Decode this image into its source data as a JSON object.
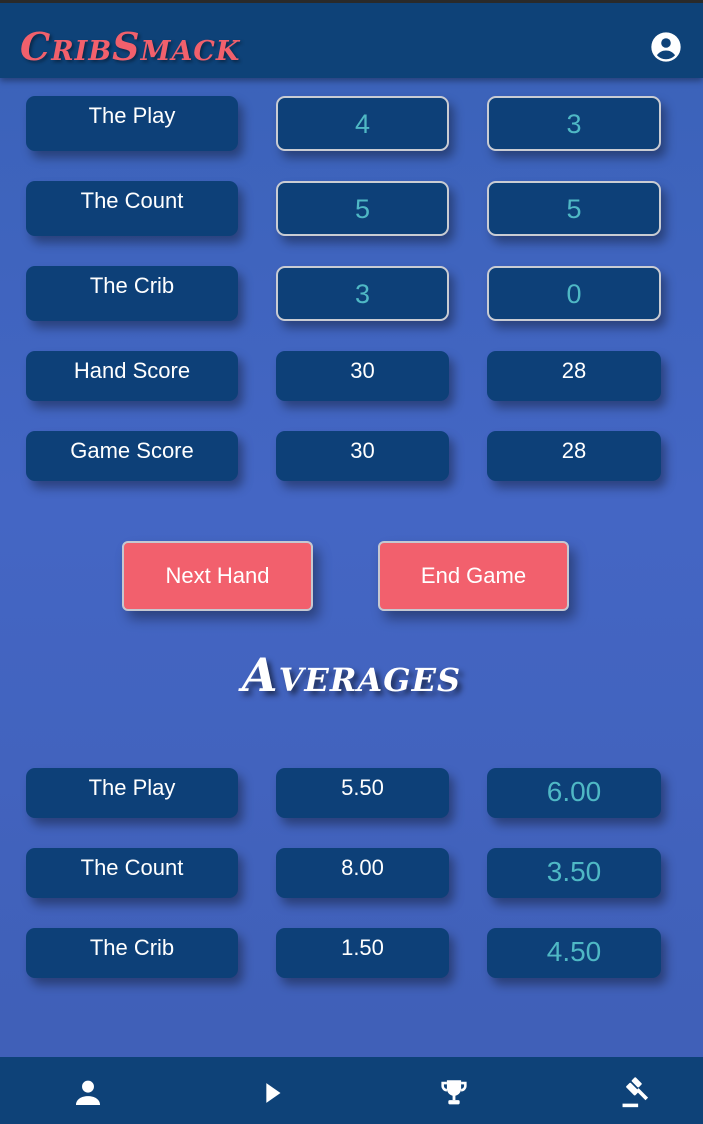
{
  "app": {
    "title": "CribSmack",
    "account_icon": "account-circle-icon"
  },
  "scores": {
    "rows": [
      {
        "label": "The Play",
        "p1": "4",
        "p2": "3"
      },
      {
        "label": "The Count",
        "p1": "5",
        "p2": "5"
      },
      {
        "label": "The Crib",
        "p1": "3",
        "p2": "0"
      },
      {
        "label": "Hand Score",
        "p1": "30",
        "p2": "28"
      },
      {
        "label": "Game Score",
        "p1": "30",
        "p2": "28"
      }
    ]
  },
  "actions": {
    "next_hand": "Next Hand",
    "end_game": "End Game"
  },
  "averages": {
    "title": "Averages",
    "rows": [
      {
        "label": "The Play",
        "p1": "5.50",
        "p2": "6.00"
      },
      {
        "label": "The Count",
        "p1": "8.00",
        "p2": "3.50"
      },
      {
        "label": "The Crib",
        "p1": "1.50",
        "p2": "4.50"
      }
    ]
  },
  "bottom_nav": [
    "person-icon",
    "play-icon",
    "trophy-icon",
    "gavel-icon"
  ],
  "colors": {
    "bar": "#0e4278",
    "accent": "#f2606d",
    "teal": "#4fb8c5",
    "background": "#4466c4"
  }
}
